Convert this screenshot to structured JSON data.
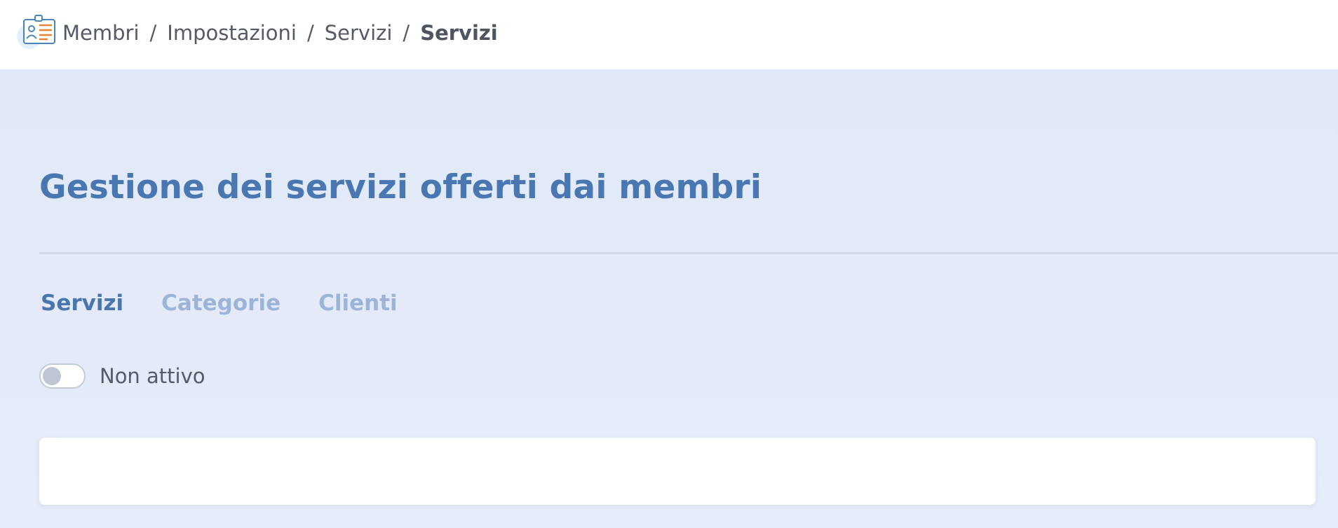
{
  "header": {
    "app_icon": "member-card-icon",
    "breadcrumb": {
      "items": [
        "Membri",
        "Impostazioni",
        "Servizi"
      ],
      "separator": "/",
      "current": "Servizi"
    }
  },
  "main": {
    "title": "Gestione dei servizi offerti dai membri",
    "tabs": [
      {
        "label": "Servizi",
        "active": true
      },
      {
        "label": "Categorie",
        "active": false
      },
      {
        "label": "Clienti",
        "active": false
      }
    ],
    "toggle": {
      "label": "Non attivo",
      "on": false
    }
  },
  "colors": {
    "accent": "#4977b1",
    "inactive_tab": "#9bb4d8",
    "background": "#e4eaf7",
    "text": "#555b66"
  }
}
